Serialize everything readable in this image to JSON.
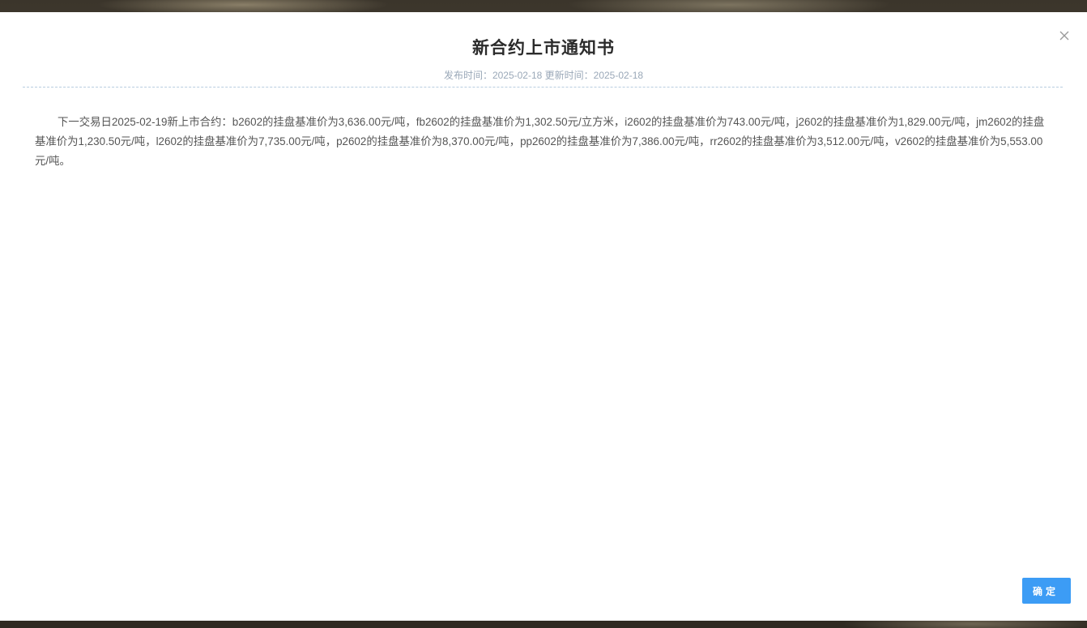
{
  "dialog": {
    "title": "新合约上市通知书",
    "meta": "发布时间：2025-02-18 更新时间：2025-02-18",
    "content": "下一交易日2025-02-19新上市合约：b2602的挂盘基准价为3,636.00元/吨，fb2602的挂盘基准价为1,302.50元/立方米，i2602的挂盘基准价为743.00元/吨，j2602的挂盘基准价为1,829.00元/吨，jm2602的挂盘基准价为1,230.50元/吨，l2602的挂盘基准价为7,735.00元/吨，p2602的挂盘基准价为8,370.00元/吨，pp2602的挂盘基准价为7,386.00元/吨，rr2602的挂盘基准价为3,512.00元/吨，v2602的挂盘基准价为5,553.00元/吨。",
    "confirm_label": "确定",
    "close_icon": "close-icon"
  },
  "colors": {
    "confirm_button": "#3c9cf5",
    "meta_text": "#9aa8b8",
    "divider": "#b8cde0"
  }
}
